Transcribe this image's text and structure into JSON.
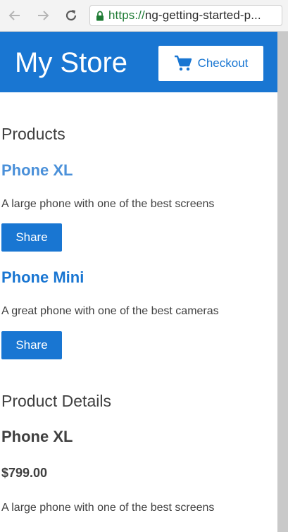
{
  "browser": {
    "url_scheme": "https://",
    "url_rest": "ng-getting-started-p..."
  },
  "header": {
    "title": "My Store",
    "checkout_label": "Checkout"
  },
  "products_section": {
    "heading": "Products",
    "items": [
      {
        "name": "Phone XL",
        "description": "A large phone with one of the best screens",
        "share_label": "Share"
      },
      {
        "name": "Phone Mini",
        "description": "A great phone with one of the best cameras",
        "share_label": "Share"
      }
    ]
  },
  "details_section": {
    "heading": "Product Details",
    "name": "Phone XL",
    "price": "$799.00",
    "description": "A large phone with one of the best screens"
  },
  "colors": {
    "primary": "#1976d2",
    "text": "#404040",
    "secure_green": "#1e7b34"
  }
}
